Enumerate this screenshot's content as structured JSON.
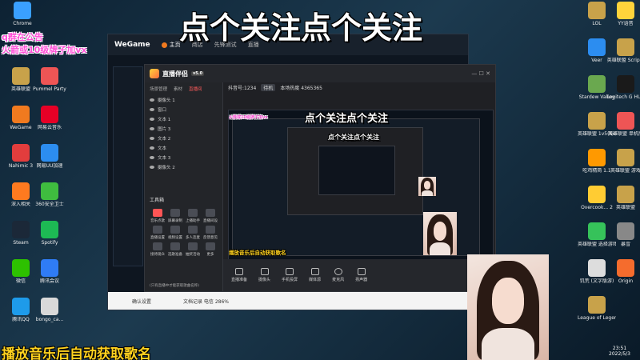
{
  "overlay": {
    "top_banner": "点个关注点个关注",
    "pink_line1": "q群在公告",
    "pink_line2": "火箭或10级牌子加vx",
    "bottom_banner": "播放音乐后自动获取歌名",
    "companion_banner": "点个关注点个关注",
    "nested_banner": "点个关注点个关注",
    "nested_bottom": "播放音乐后自动获取歌名"
  },
  "desktop_left_icons": [
    {
      "label": "Chrome",
      "icon": "chrome-icon",
      "color": "#3aa0ff"
    },
    {
      "label": "英雄联盟",
      "icon": "lol-icon",
      "color": "#c8a24a"
    },
    {
      "label": "WeGame",
      "icon": "wegame-icon",
      "color": "#f07a1f"
    },
    {
      "label": "Nahimic 3",
      "icon": "nahimic-icon",
      "color": "#e23d3d"
    },
    {
      "label": "深入相关",
      "icon": "app-icon",
      "color": "#ff7a1f"
    },
    {
      "label": "Steam",
      "icon": "steam-icon",
      "color": "#1b2838"
    },
    {
      "label": "微信",
      "icon": "wechat-icon",
      "color": "#2dc100"
    },
    {
      "label": "腾讯QQ",
      "icon": "qq-icon",
      "color": "#1e9bea"
    },
    {
      "label": "Pummel Party",
      "icon": "party-icon",
      "color": "#e55"
    },
    {
      "label": "网易云音乐",
      "icon": "music-icon",
      "color": "#e60026"
    },
    {
      "label": "网易UU加速",
      "icon": "uu-icon",
      "color": "#2c8df0"
    },
    {
      "label": "360安全卫士",
      "icon": "shield-icon",
      "color": "#3fbd3f"
    },
    {
      "label": "Spotify",
      "icon": "spotify-icon",
      "color": "#1db954"
    },
    {
      "label": "腾讯会议",
      "icon": "meeting-icon",
      "color": "#2f7cf6"
    },
    {
      "label": "bongo_ca...",
      "icon": "file-icon",
      "color": "#d9d9d9"
    }
  ],
  "desktop_right_icons": [
    {
      "label": "LOL",
      "icon": "lol-icon",
      "color": "#c8a24a"
    },
    {
      "label": "Veer",
      "icon": "veer-icon",
      "color": "#2c8df0"
    },
    {
      "label": "Stardew Valley",
      "icon": "stardew-icon",
      "color": "#6aa84f"
    },
    {
      "label": "英雄联盟 1v5(Not...",
      "icon": "lol-icon",
      "color": "#c8a24a"
    },
    {
      "label": "吃鸡精简 1.1",
      "icon": "game-icon",
      "color": "#ff9900"
    },
    {
      "label": "Overcook... 2",
      "icon": "overcooked-icon",
      "color": "#ffcc33"
    },
    {
      "label": "英雄联盟 选择游戏",
      "icon": "lol-icon",
      "color": "#36c25a"
    },
    {
      "label": "饥荒 (文字版游)",
      "icon": "dst-icon",
      "color": "#ddd"
    },
    {
      "label": "League of Legends",
      "icon": "lol-icon",
      "color": "#c8a24a"
    },
    {
      "label": "YY语音",
      "icon": "yy-icon",
      "color": "#ffd43b"
    },
    {
      "label": "英雄联盟 Scripts",
      "icon": "lol-icon",
      "color": "#c8a24a"
    },
    {
      "label": "Logitech G HUB",
      "icon": "logitech-icon",
      "color": "#1a1a1a"
    },
    {
      "label": "英雄联盟 单机版",
      "icon": "lol-icon",
      "color": "#e55"
    },
    {
      "label": "英雄联盟 游戏",
      "icon": "lol-icon",
      "color": "#c8a24a"
    },
    {
      "label": "英雄联盟",
      "icon": "lol-icon",
      "color": "#c8a24a"
    },
    {
      "label": "暴雪",
      "icon": "blizzard-icon",
      "color": "#888"
    },
    {
      "label": "Origin",
      "icon": "origin-icon",
      "color": "#f56c2d"
    }
  ],
  "wegame": {
    "logo": "WeGame",
    "tabs": [
      "主页",
      "商店",
      "先锋测试",
      "直播"
    ],
    "footer_left": "确认设置",
    "footer_right": "文档记录 电信 286%"
  },
  "companion": {
    "brand": "直播伴侣",
    "version": "v5.0",
    "side_tabs": [
      "场景管理",
      "素材",
      "直播间"
    ],
    "scenes": [
      "摄像头 1",
      "窗口",
      "文本 1",
      "图片 3",
      "文本 2",
      "文本",
      "文本 3",
      "摄像头 2"
    ],
    "tool_title": "工具箱",
    "tools": [
      {
        "label": "音乐点歌",
        "red": true
      },
      {
        "label": "屏幕录制",
        "red": false
      },
      {
        "label": "上播助手",
        "red": false
      },
      {
        "label": "直播间设",
        "red": false
      },
      {
        "label": "直播设置",
        "red": false
      },
      {
        "label": "视频设置",
        "red": false
      },
      {
        "label": "多人连麦",
        "red": false
      },
      {
        "label": "反馈意见",
        "red": false
      },
      {
        "label": "接待观众",
        "red": false
      },
      {
        "label": "选歌准备",
        "red": false
      },
      {
        "label": "抽奖活动",
        "red": false
      },
      {
        "label": "更多",
        "red": false
      }
    ],
    "room_id": "抖音号:1234",
    "room_status": "待机",
    "room_stats": "本场热度 4365365",
    "bottom_buttons": [
      "直播准备",
      "摄像头",
      "手机投屏",
      "媒体源",
      "麦克风",
      "扬声器"
    ],
    "hint": "(只有直播中才能获取歌曲名称)"
  },
  "clock": {
    "time": "23:51",
    "date": "2022/5/3"
  }
}
